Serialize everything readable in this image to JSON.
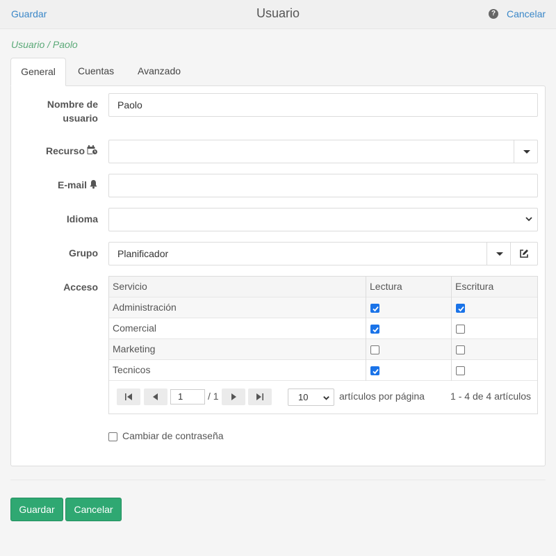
{
  "header": {
    "save_link": "Guardar",
    "title": "Usuario",
    "help_glyph": "?",
    "cancel_link": "Cancelar"
  },
  "breadcrumb": "Usuario / Paolo",
  "tabs": [
    {
      "label": "General",
      "active": true
    },
    {
      "label": "Cuentas",
      "active": false
    },
    {
      "label": "Avanzado",
      "active": false
    }
  ],
  "form": {
    "username": {
      "label_line1": "Nombre de",
      "label_line2": "usuario",
      "value": "Paolo"
    },
    "resource": {
      "label": "Recurso",
      "icon": "calendar-clock-icon",
      "value": ""
    },
    "email": {
      "label": "E-mail",
      "icon": "bell-icon",
      "value": ""
    },
    "language": {
      "label": "Idioma",
      "value": ""
    },
    "group": {
      "label": "Grupo",
      "value": "Planificador"
    },
    "access": {
      "label": "Acceso"
    }
  },
  "access_grid": {
    "columns": [
      "Servicio",
      "Lectura",
      "Escritura"
    ],
    "rows": [
      {
        "service": "Administración",
        "read": true,
        "write": true
      },
      {
        "service": "Comercial",
        "read": true,
        "write": false
      },
      {
        "service": "Marketing",
        "read": false,
        "write": false
      },
      {
        "service": "Tecnicos",
        "read": true,
        "write": false
      }
    ],
    "pager": {
      "page": "1",
      "total_pages": "/ 1",
      "page_size": "10",
      "page_size_label": "artículos por página",
      "info": "1 - 4 de 4 artículos"
    }
  },
  "change_password": {
    "label": "Cambiar de contraseña",
    "checked": false
  },
  "footer": {
    "save_button": "Guardar",
    "cancel_button": "Cancelar"
  },
  "colors": {
    "link": "#3a87c8",
    "breadcrumb": "#5aa977",
    "primary_button": "#2fa872",
    "checkbox_checked": "#1a73e8"
  }
}
